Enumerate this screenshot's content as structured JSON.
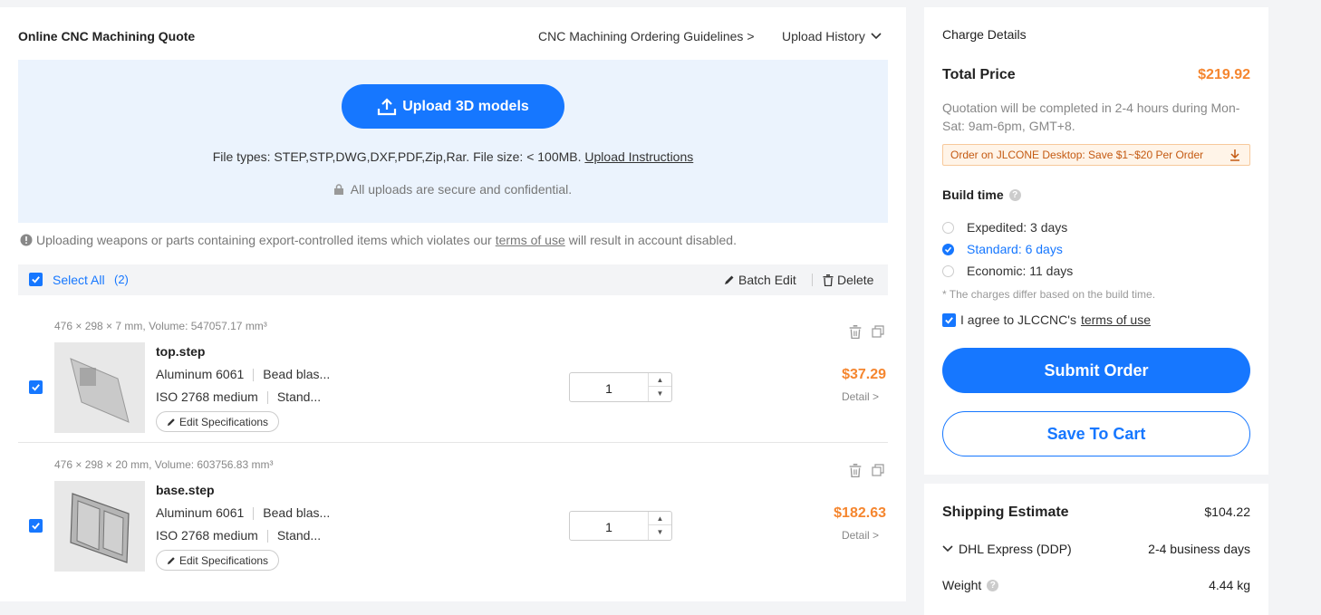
{
  "header": {
    "title": "Online CNC Machining Quote",
    "guidelines_link": "CNC Machining Ordering Guidelines >",
    "upload_history": "Upload History"
  },
  "upload": {
    "button_label": "Upload 3D models",
    "file_types": "File types: STEP,STP,DWG,DXF,PDF,Zip,Rar. File size: < 100MB.",
    "instructions_link": "Upload Instructions",
    "secure_note": "All uploads are secure and confidential."
  },
  "warning": {
    "prefix": "Uploading weapons or parts containing export-controlled items which violates our",
    "link": "terms of use",
    "suffix": "will result in account disabled."
  },
  "selection": {
    "select_all_label": "Select All",
    "count": "(2)",
    "batch_edit_label": "Batch Edit",
    "delete_label": "Delete"
  },
  "parts": [
    {
      "dims": "476 × 298 × 7 mm, Volume: 547057.17 mm³",
      "filename": "top.step",
      "material": "Aluminum 6061",
      "finish": "Bead blas...",
      "tolerance": "ISO 2768 medium",
      "thread": "Stand...",
      "edit_label": "Edit Specifications",
      "quantity": "1",
      "price": "$37.29",
      "detail_link": "Detail >"
    },
    {
      "dims": "476 × 298 × 20 mm, Volume: 603756.83 mm³",
      "filename": "base.step",
      "material": "Aluminum 6061",
      "finish": "Bead blas...",
      "tolerance": "ISO 2768 medium",
      "thread": "Stand...",
      "edit_label": "Edit Specifications",
      "quantity": "1",
      "price": "$182.63",
      "detail_link": "Detail >"
    }
  ],
  "charge": {
    "title": "Charge Details",
    "total_label": "Total Price",
    "total_value": "$219.92",
    "quote_note": "Quotation will be completed in 2-4 hours during Mon-Sat: 9am-6pm, GMT+8.",
    "promo": "Order on JLCONE Desktop: Save $1~$20 Per Order",
    "build_time_label": "Build time",
    "options": [
      {
        "label": "Expedited: 3 days",
        "selected": false
      },
      {
        "label": "Standard: 6 days",
        "selected": true
      },
      {
        "label": "Economic: 11 days",
        "selected": false
      }
    ],
    "build_note": "* The charges differ based on the build time.",
    "agree_prefix": "I agree to JLCCNC's",
    "agree_link": "terms of use",
    "submit_label": "Submit Order",
    "cart_label": "Save To Cart"
  },
  "shipping": {
    "title": "Shipping Estimate",
    "value": "$104.22",
    "carrier": "DHL Express (DDP)",
    "carrier_days": "2-4 business days",
    "weight_label": "Weight",
    "weight_value": "4.44 kg"
  },
  "colors": {
    "accent": "#1677ff",
    "price": "#f5862f",
    "upload_bg": "#ebf3fd"
  }
}
